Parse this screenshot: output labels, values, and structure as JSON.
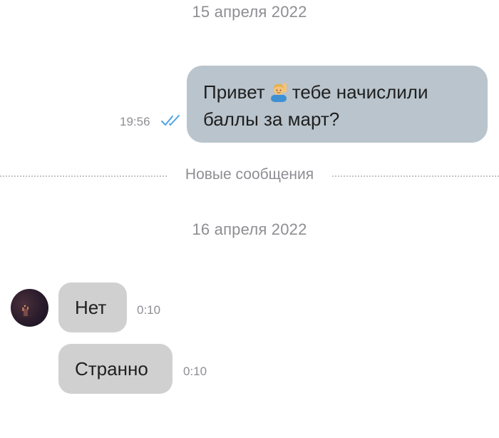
{
  "chat": {
    "date_first": "15 апреля 2022",
    "date_second": "16 апреля 2022",
    "new_messages_label": "Новые сообщения",
    "outgoing": {
      "text_before_emoji": "Привет",
      "emoji_name": "person-raising-hand-emoji",
      "text_after_emoji": "тебе начислили баллы за март?",
      "time": "19:56",
      "status": "read"
    },
    "incoming": [
      {
        "text": "Нет",
        "time": "0:10"
      },
      {
        "text": "Странно",
        "time": "0:10"
      }
    ]
  },
  "colors": {
    "outgoing_bubble": "#b9c4cc",
    "incoming_bubble": "#d0d0d0",
    "read_check": "#4fa3e3",
    "meta_text": "#8e8e93"
  }
}
